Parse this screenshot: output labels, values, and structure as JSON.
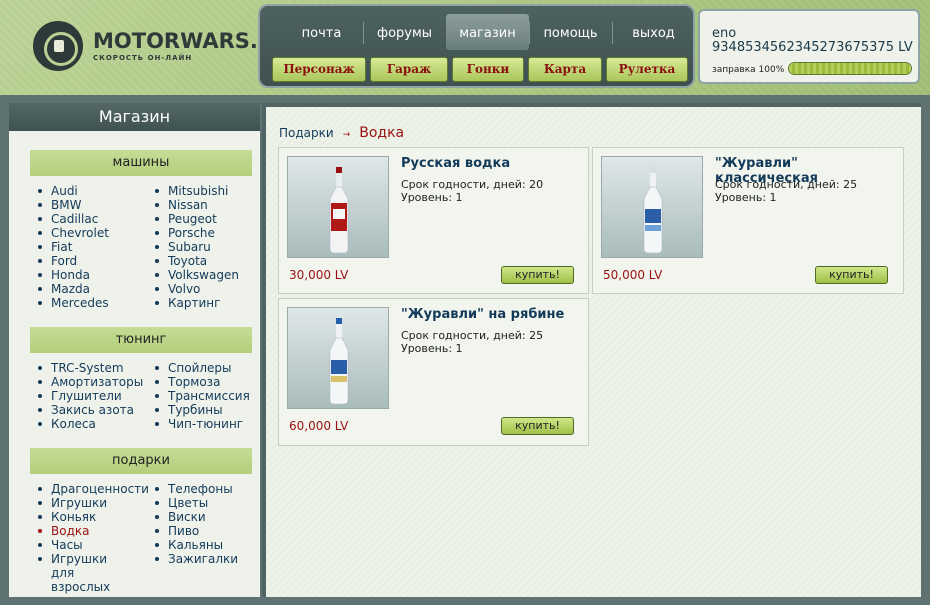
{
  "logo": {
    "title": "MOTORWARS.RU",
    "subtitle": "СКОРОСТЬ ОН-ЛАЙН"
  },
  "nav": {
    "tabs": [
      {
        "label": "почта"
      },
      {
        "label": "форумы"
      },
      {
        "label": "магазин",
        "active": true
      },
      {
        "label": "помощь"
      },
      {
        "label": "выход"
      }
    ],
    "buttons": [
      {
        "label": "Персонаж"
      },
      {
        "label": "Гараж"
      },
      {
        "label": "Гонки"
      },
      {
        "label": "Карта"
      },
      {
        "label": "Рулетка"
      }
    ]
  },
  "user": {
    "name": "eno",
    "money": "9348534562345273675375 LV",
    "fuel_label": "заправка 100%",
    "fuel_percent": 100
  },
  "sidebar": {
    "title": "Магазин",
    "categories": [
      {
        "title": "машины",
        "col1": [
          "Audi",
          "BMW",
          "Cadillac",
          "Chevrolet",
          "Fiat",
          "Ford",
          "Honda",
          "Mazda",
          "Mercedes"
        ],
        "col2": [
          "Mitsubishi",
          "Nissan",
          "Peugeot",
          "Porsche",
          "Subaru",
          "Toyota",
          "Volkswagen",
          "Volvo",
          "Картинг"
        ]
      },
      {
        "title": "тюнинг",
        "col1": [
          "TRC-System",
          "Амортизаторы",
          "Глушители",
          "Закись азота",
          "Колеса"
        ],
        "col2": [
          "Спойлеры",
          "Тормоза",
          "Трансмиссия",
          "Турбины",
          "Чип-тюнинг"
        ]
      },
      {
        "title": "подарки",
        "col1": [
          "Драгоценности",
          "Игрушки",
          "Коньяк",
          "Водка",
          "Часы",
          "Игрушки для взрослых"
        ],
        "col2": [
          "Телефоны",
          "Цветы",
          "Виски",
          "Пиво",
          "Кальяны",
          "Зажигалки"
        ],
        "active": "Водка"
      }
    ]
  },
  "breadcrumb": {
    "parent": "Подарки",
    "arrow": "→",
    "current": "Водка"
  },
  "products": [
    {
      "title": "Русская водка",
      "shelf_life": "Срок годности, дней: 20",
      "level": "Уровень: 1",
      "price": "30,000 LV",
      "buy": "купить!"
    },
    {
      "title": "\"Журавли\" классическая",
      "shelf_life": "Срок годности, дней: 25",
      "level": "Уровень: 1",
      "price": "50,000 LV",
      "buy": "купить!"
    },
    {
      "title": "\"Журавли\" на рябине",
      "shelf_life": "Срок годности, дней: 25",
      "level": "Уровень: 1",
      "price": "60,000 LV",
      "buy": "купить!"
    }
  ]
}
